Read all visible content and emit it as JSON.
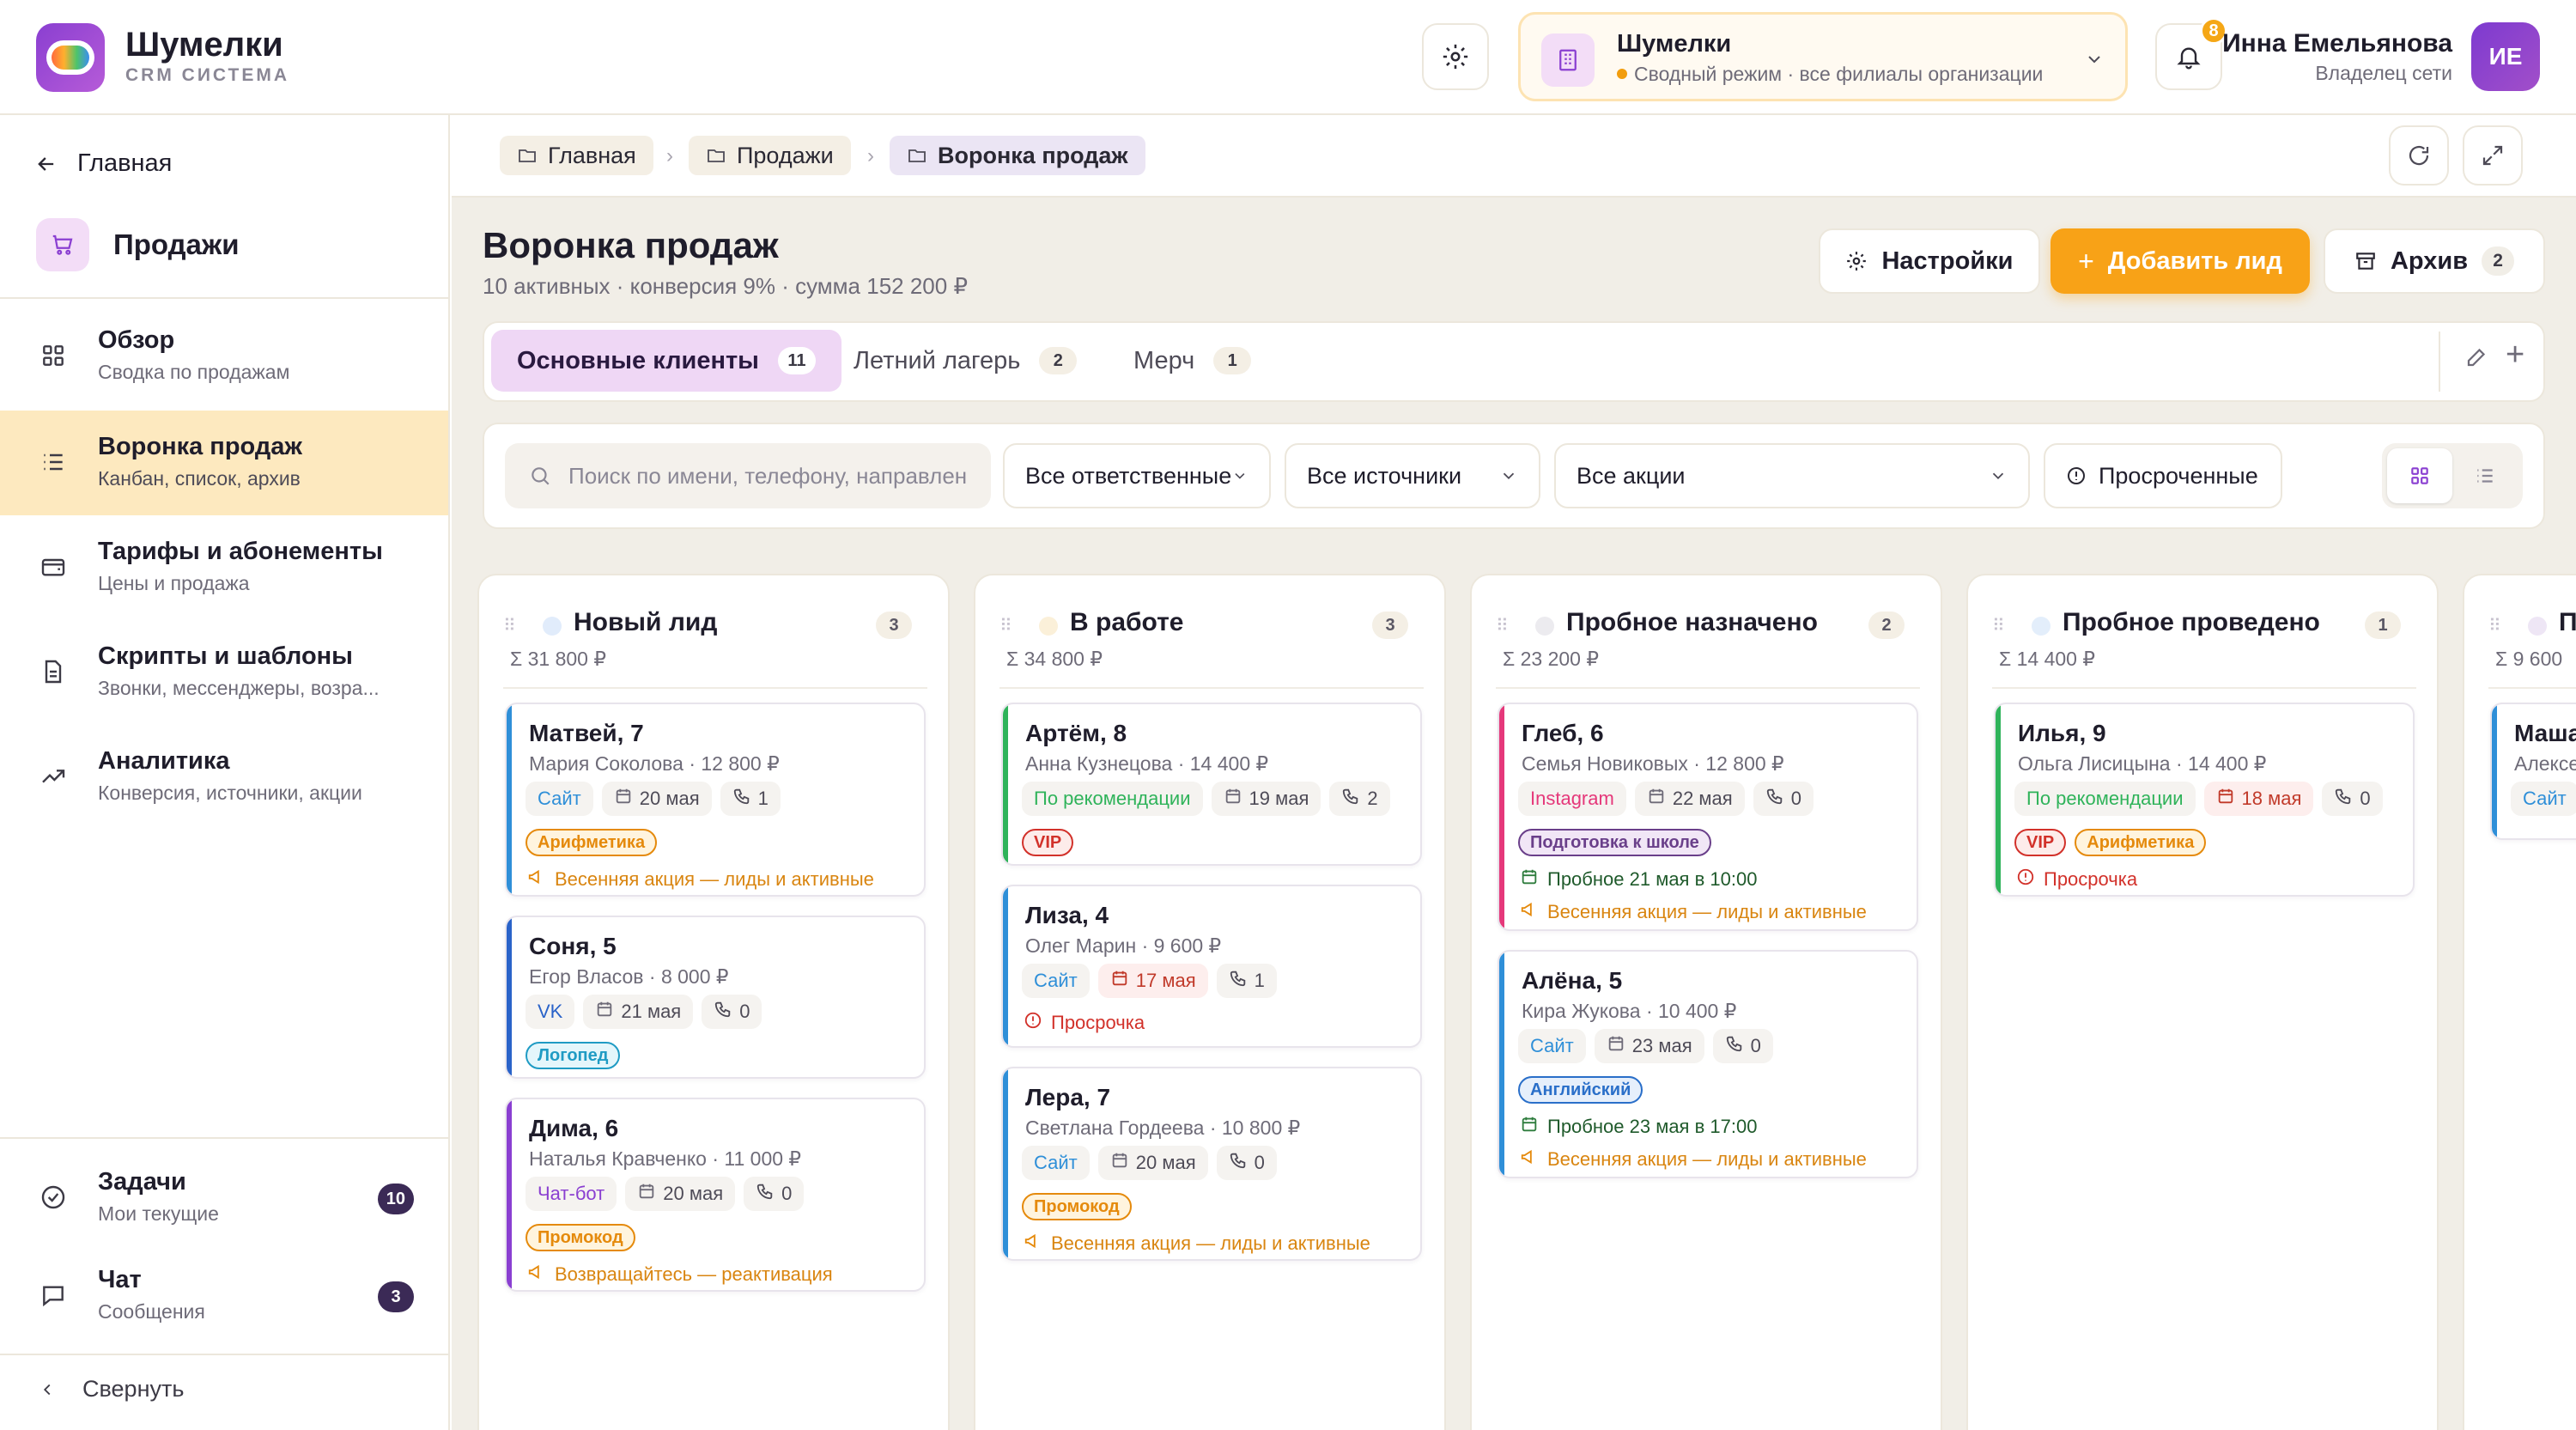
{
  "brand": {
    "title": "Шумелки",
    "subtitle": "CRM СИСТЕМА"
  },
  "org": {
    "title": "Шумелки",
    "subtitle": "Сводный режим · все филиалы организации"
  },
  "notifications": {
    "count": "8"
  },
  "user": {
    "name": "Инна Емельянова",
    "role": "Владелец сети",
    "initials": "ИЕ"
  },
  "sidebar": {
    "back_label": "Главная",
    "section_title": "Продажи",
    "items": [
      {
        "title": "Обзор",
        "subtitle": "Сводка по продажам",
        "icon": "grid-icon"
      },
      {
        "title": "Воронка продаж",
        "subtitle": "Канбан, список, архив",
        "icon": "list-icon"
      },
      {
        "title": "Тарифы и абонементы",
        "subtitle": "Цены и продажа",
        "icon": "wallet-icon"
      },
      {
        "title": "Скрипты и шаблоны",
        "subtitle": "Звонки, мессенджеры, возра...",
        "icon": "document-icon"
      },
      {
        "title": "Аналитика",
        "subtitle": "Конверсия, источники, акции",
        "icon": "trend-icon"
      }
    ],
    "bottom": [
      {
        "title": "Задачи",
        "subtitle": "Мои текущие",
        "count": "10"
      },
      {
        "title": "Чат",
        "subtitle": "Сообщения",
        "count": "3"
      }
    ],
    "collapse_label": "Свернуть"
  },
  "breadcrumbs": [
    "Главная",
    "Продажи",
    "Воронка продаж"
  ],
  "page": {
    "title": "Воронка продаж",
    "subtitle": "10 активных · конверсия 9% · сумма 152 200 ₽"
  },
  "actions": {
    "settings": "Настройки",
    "add_lead": "Добавить лид",
    "archive": "Архив",
    "archive_count": "2"
  },
  "tabs": [
    {
      "label": "Основные клиенты",
      "count": "11"
    },
    {
      "label": "Летний лагерь",
      "count": "2"
    },
    {
      "label": "Мерч",
      "count": "1"
    }
  ],
  "filters": {
    "search_placeholder": "Поиск по имени, телефону, направлен",
    "responsible": "Все ответственные",
    "sources": "Все источники",
    "promos": "Все акции",
    "overdue": "Просроченные"
  },
  "colors": {
    "accent": "#f8a217",
    "purple": "#8a3fd1",
    "active_nav": "#fde9bf",
    "board_bg": "#f1eee7"
  },
  "columns": [
    {
      "title": "Новый лид",
      "sum": "Σ 31 800 ₽",
      "count": "3",
      "dot": "#e1ecfb",
      "cards": [
        {
          "name": "Матвей, 7",
          "sub": "Мария Соколова · 12 800 ₽",
          "bar": "#2f8fd8",
          "source": "Сайт",
          "source_color": "#2f8fd8",
          "date": "20 мая",
          "date_red": false,
          "calls": "1",
          "tags": [
            {
              "label": "Арифметика",
              "color": "#e58a0c",
              "bg": "#fff4de"
            }
          ],
          "note": "Весенняя акция — лиды и активные",
          "note_kind": "promo"
        },
        {
          "name": "Соня, 5",
          "sub": "Егор Власов · 8 000 ₽",
          "bar": "#2a63c9",
          "source": "VK",
          "source_color": "#2a63c9",
          "date": "21 мая",
          "date_red": false,
          "calls": "0",
          "tags": [
            {
              "label": "Логопед",
              "color": "#1f9bc4",
              "bg": "#e4f6fb"
            }
          ],
          "note": "",
          "note_kind": ""
        },
        {
          "name": "Дима, 6",
          "sub": "Наталья Кравченко · 11 000 ₽",
          "bar": "#8a3fd1",
          "source": "Чат-бот",
          "source_color": "#8a3fd1",
          "date": "20 мая",
          "date_red": false,
          "calls": "0",
          "tags": [
            {
              "label": "Промокод",
              "color": "#e58a0c",
              "bg": "#fff4de"
            }
          ],
          "note": "Возвращайтесь — реактивация",
          "note_kind": "promo"
        }
      ]
    },
    {
      "title": "В работе",
      "sum": "Σ 34 800 ₽",
      "count": "3",
      "dot": "#fbf0d9",
      "cards": [
        {
          "name": "Артём, 8",
          "sub": "Анна Кузнецова · 14 400 ₽",
          "bar": "#2fb35a",
          "source": "По рекомендации",
          "source_color": "#2fb35a",
          "date": "19 мая",
          "date_red": false,
          "calls": "2",
          "tags": [
            {
              "label": "VIP",
              "color": "#d2312a",
              "bg": "#fdecea"
            }
          ],
          "note": "",
          "note_kind": ""
        },
        {
          "name": "Лиза, 4",
          "sub": "Олег Марин · 9 600 ₽",
          "bar": "#2f8fd8",
          "source": "Сайт",
          "source_color": "#2f8fd8",
          "date": "17 мая",
          "date_red": true,
          "calls": "1",
          "tags": [],
          "note": "Просрочка",
          "note_kind": "overdue"
        },
        {
          "name": "Лера, 7",
          "sub": "Светлана Гордеева · 10 800 ₽",
          "bar": "#2f8fd8",
          "source": "Сайт",
          "source_color": "#2f8fd8",
          "date": "20 мая",
          "date_red": false,
          "calls": "0",
          "tags": [
            {
              "label": "Промокод",
              "color": "#e58a0c",
              "bg": "#fff4de"
            }
          ],
          "note": "Весенняя акция — лиды и активные",
          "note_kind": "promo"
        }
      ]
    },
    {
      "title": "Пробное назначено",
      "sum": "Σ 23 200 ₽",
      "count": "2",
      "dot": "#ecebef",
      "cards": [
        {
          "name": "Глеб, 6",
          "sub": "Семья Новиковых · 12 800 ₽",
          "bar": "#e5387a",
          "source": "Instagram",
          "source_color": "#e5387a",
          "date": "22 мая",
          "date_red": false,
          "calls": "0",
          "tags": [
            {
              "label": "Подготовка к школе",
              "color": "#6a3f8a",
              "bg": "#f1e6f6"
            }
          ],
          "trial": "Пробное 21 мая в 10:00",
          "note": "Весенняя акция — лиды и активные",
          "note_kind": "promo"
        },
        {
          "name": "Алёна, 5",
          "sub": "Кира Жукова · 10 400 ₽",
          "bar": "#2f8fd8",
          "source": "Сайт",
          "source_color": "#2f8fd8",
          "date": "23 мая",
          "date_red": false,
          "calls": "0",
          "tags": [
            {
              "label": "Английский",
              "color": "#2a6fc9",
              "bg": "#e6effb"
            }
          ],
          "trial": "Пробное 23 мая в 17:00",
          "note": "Весенняя акция — лиды и активные",
          "note_kind": "promo"
        }
      ]
    },
    {
      "title": "Пробное проведено",
      "sum": "Σ 14 400 ₽",
      "count": "1",
      "dot": "#e3eefb",
      "cards": [
        {
          "name": "Илья, 9",
          "sub": "Ольга Лисицына · 14 400 ₽",
          "bar": "#2fb35a",
          "source": "По рекомендации",
          "source_color": "#2fb35a",
          "date": "18 мая",
          "date_red": true,
          "calls": "0",
          "tags": [
            {
              "label": "VIP",
              "color": "#d2312a",
              "bg": "#fdecea"
            },
            {
              "label": "Арифметика",
              "color": "#e58a0c",
              "bg": "#fff4de"
            }
          ],
          "note": "Просрочка",
          "note_kind": "overdue"
        }
      ]
    },
    {
      "title": "П",
      "sum": "Σ 9 600",
      "count": "",
      "dot": "#eee6f5",
      "cards": [
        {
          "name": "Маша",
          "sub": "Алексе",
          "bar": "#2f8fd8",
          "source": "Сайт",
          "source_color": "#2f8fd8",
          "date": "",
          "date_red": false,
          "calls": "",
          "tags": [],
          "note": "",
          "note_kind": ""
        }
      ]
    }
  ]
}
